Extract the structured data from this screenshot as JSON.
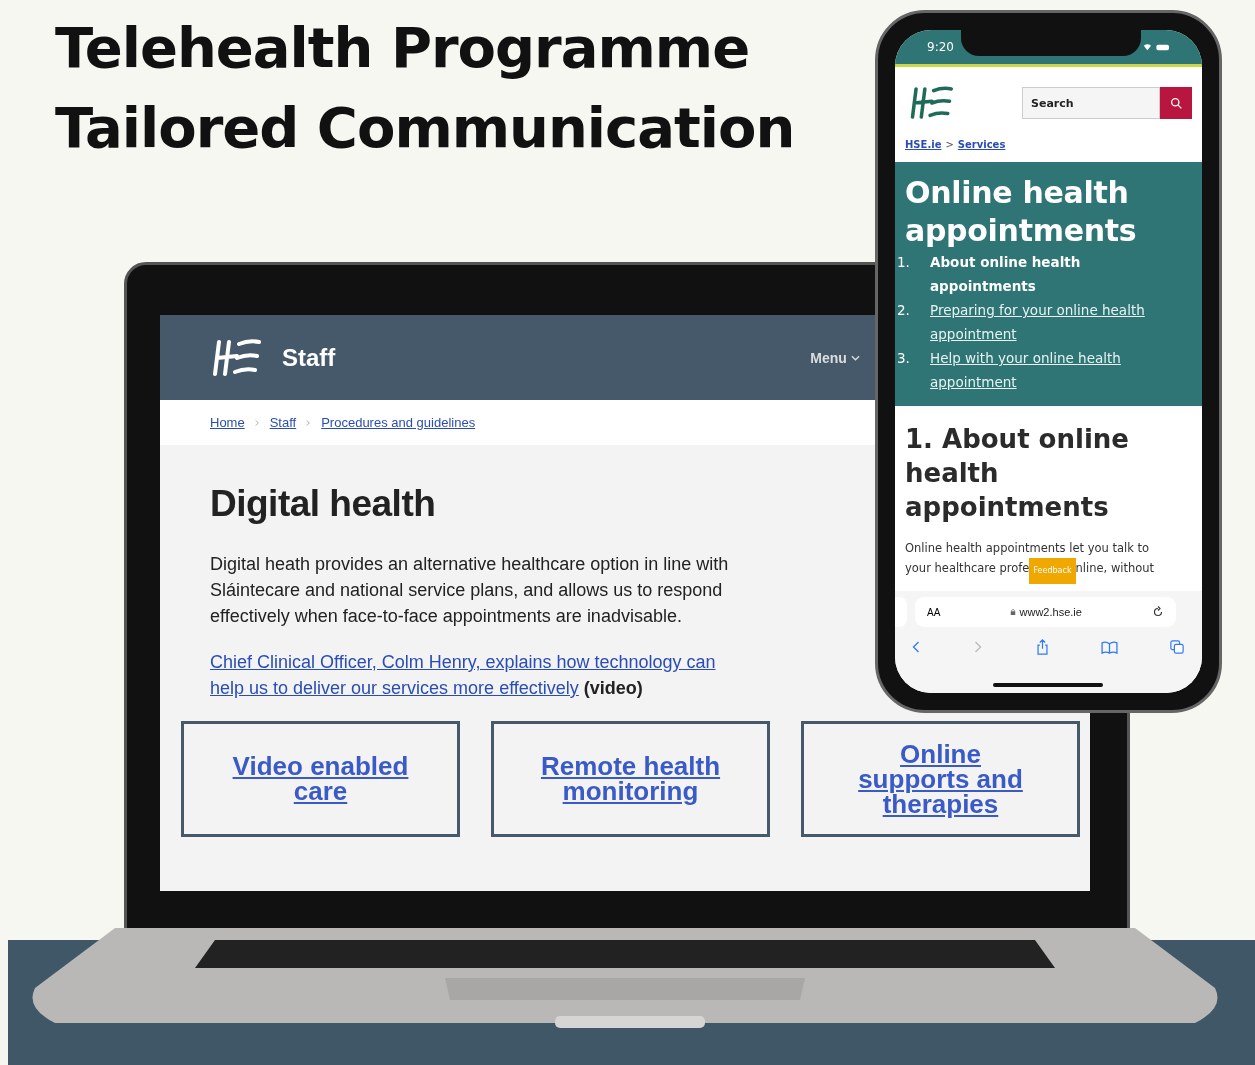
{
  "title": {
    "lines": [
      "Telehealth Programme",
      "Tailored Communication"
    ]
  },
  "laptop_site": {
    "header": {
      "section": "Staff",
      "menu": "Menu"
    },
    "breadcrumb": [
      "Home",
      "Staff",
      "Procedures and guidelines"
    ],
    "heading": "Digital health",
    "intro": "Digital heath provides an alternative healthcare option in line with Sláintecare and national service plans, and allows us to respond effectively when face-to-face appointments are inadvisable.",
    "video_link": {
      "lines": [
        "Chief Clinical Officer, Colm Henry, explains how technology can",
        "help us to deliver our services more effectively"
      ],
      "suffix": "(video)"
    },
    "cards": [
      "Video enabled care",
      "Remote health monitoring",
      "Online supports and therapies"
    ]
  },
  "phone_site": {
    "status_time": "9:20",
    "search": {
      "placeholder": "Search"
    },
    "breadcrumb": [
      "HSE.ie",
      "Services"
    ],
    "breadcrumb_separator": ">",
    "hero_title": "Online health appointments",
    "contents": [
      {
        "number": "1.",
        "label": "About online health appointments",
        "selected": true
      },
      {
        "number": "2.",
        "label": "Preparing for your online health appointment",
        "selected": false
      },
      {
        "number": "3.",
        "label": "Help with your online health appointment",
        "selected": false
      }
    ],
    "section_heading": "1. About online health appointments",
    "paragraph": {
      "line_1": "Online health appointments let you talk to",
      "before": "your healthcare profe",
      "feedback": "Feedback",
      "after": "nline, without"
    },
    "browser": {
      "text_size": "AA",
      "url": "www2.hse.ie"
    }
  }
}
